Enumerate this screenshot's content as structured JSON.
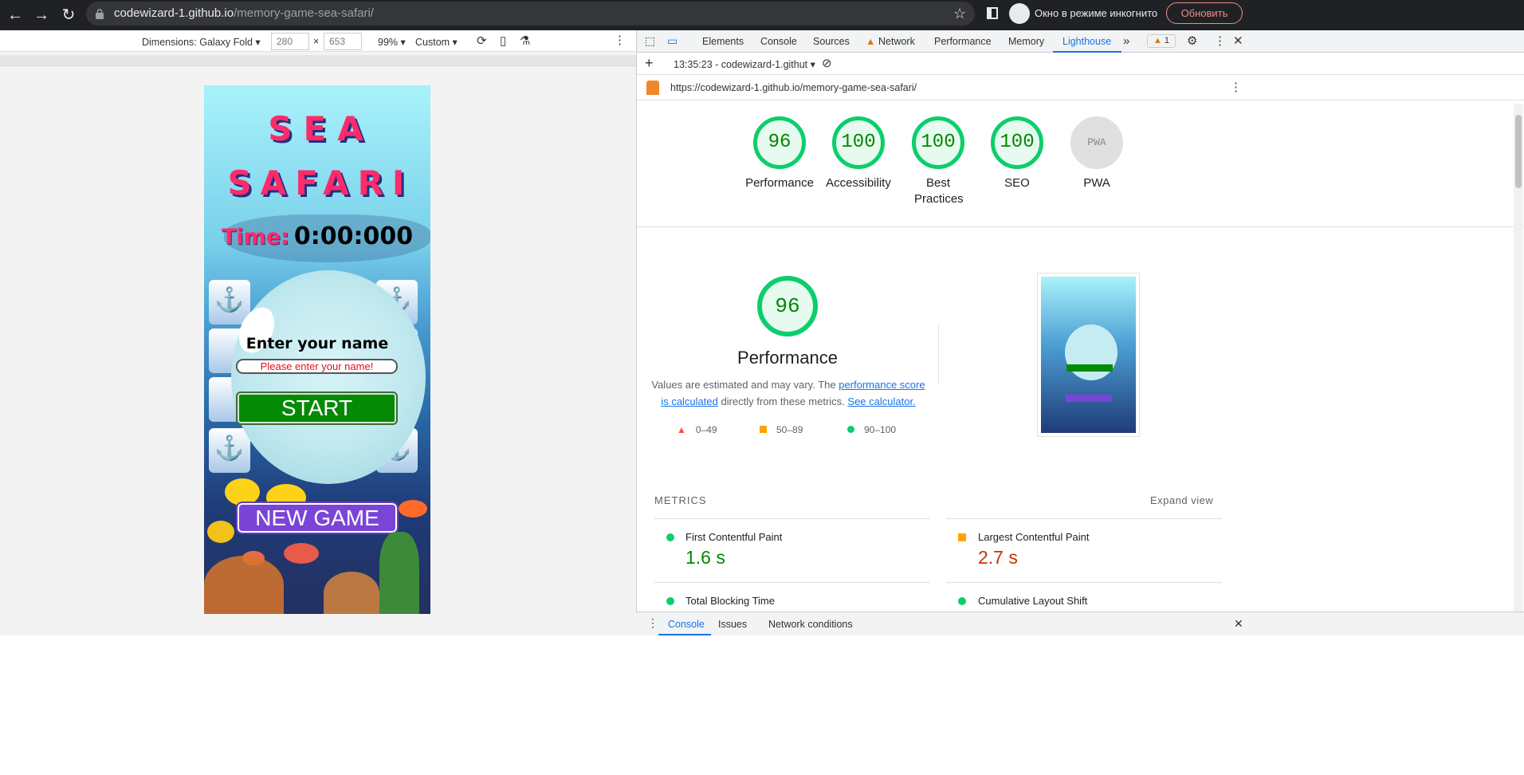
{
  "browser": {
    "url_host": "codewizard-1.github.io",
    "url_path": "/memory-game-sea-safari/",
    "incognito_label": "Окно в режиме инкогнито",
    "update_label": "Обновить"
  },
  "devtoolbar": {
    "dimensions": "Dimensions: Galaxy Fold",
    "width": "280",
    "height": "653",
    "times": "×",
    "zoom": "99%",
    "throttle": "Custom"
  },
  "game": {
    "title_line1": "SEA",
    "title_line2": "SAFARI",
    "time_label": "Time:",
    "time_value": "0:00:000",
    "enter_name": "Enter your name",
    "name_placeholder": "Please enter your name!",
    "start": "START",
    "new_game": "NEW GAME"
  },
  "devtools": {
    "tabs": [
      "Elements",
      "Console",
      "Sources",
      "Network",
      "Performance",
      "Memory",
      "Lighthouse"
    ],
    "warning_count": "1",
    "report_time": "13:35:23 - codewizard-1.githut",
    "report_url": "https://codewizard-1.github.io/memory-game-sea-safari/",
    "scores": [
      {
        "label": "Performance",
        "value": "96"
      },
      {
        "label": "Accessibility",
        "value": "100"
      },
      {
        "label": "Best Practices",
        "value": "100"
      },
      {
        "label": "SEO",
        "value": "100"
      },
      {
        "label": "PWA",
        "value": "PWA"
      }
    ],
    "perf_score": "96",
    "perf_title": "Performance",
    "perf_desc_1": "Values are estimated and may vary. The ",
    "perf_link_1": "performance score is calculated",
    "perf_desc_2": " directly from these metrics. ",
    "perf_link_2": "See calculator.",
    "legend": [
      "0–49",
      "50–89",
      "90–100"
    ],
    "metrics_label": "METRICS",
    "expand_label": "Expand view",
    "metrics": [
      {
        "name": "First Contentful Paint",
        "value": "1.6 s"
      },
      {
        "name": "Largest Contentful Paint",
        "value": "2.7 s"
      },
      {
        "name": "Total Blocking Time",
        "value": ""
      },
      {
        "name": "Cumulative Layout Shift",
        "value": ""
      }
    ],
    "drawer_tabs": [
      "Console",
      "Issues",
      "Network conditions"
    ]
  },
  "colors": {
    "pass": "#0cce6b",
    "average": "#ffa400",
    "fail": "#ff4e42",
    "accent": "#1a73e8",
    "game_pink": "#ff2a6b"
  }
}
